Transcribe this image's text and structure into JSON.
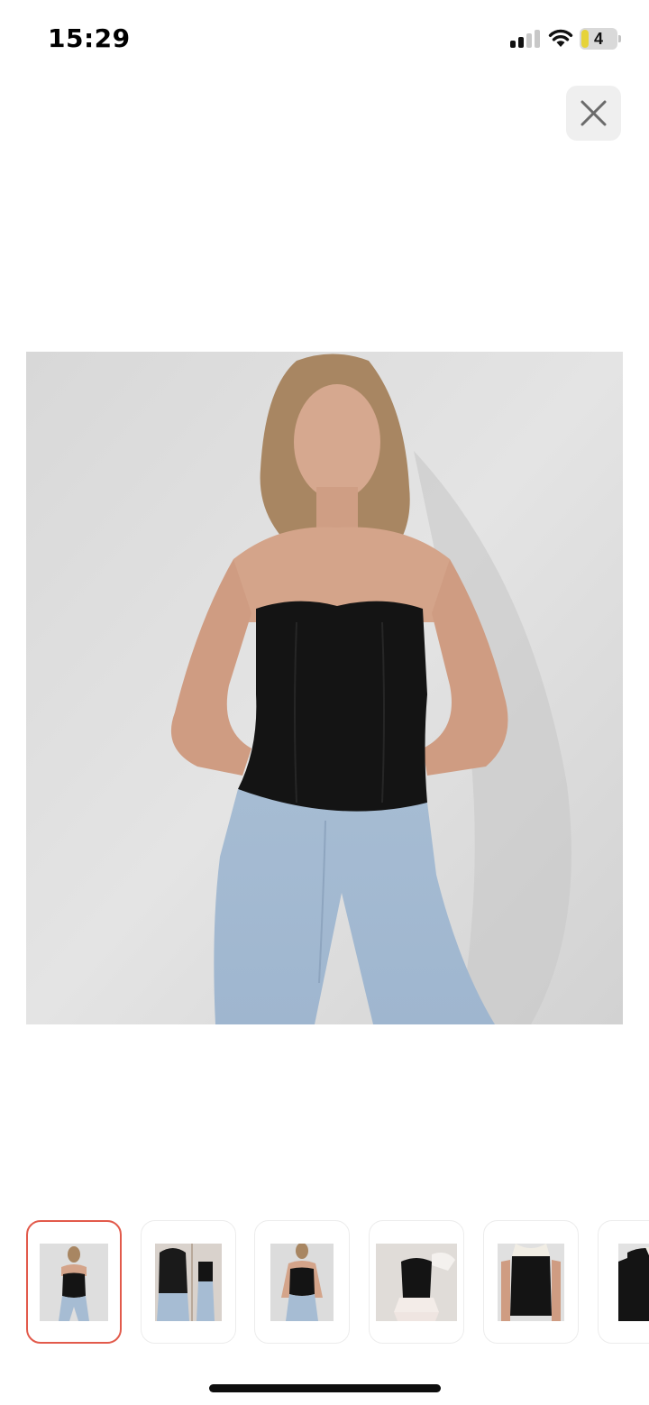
{
  "status_bar": {
    "time": "15:29",
    "battery_level": "4",
    "icons": [
      "signal-icon",
      "wifi-icon",
      "battery-icon"
    ]
  },
  "viewer": {
    "close_icon": "close-icon",
    "main_image": "product-photo-strapless-black-corset-top",
    "active_thumbnail": 1,
    "thumbnails": [
      "thumb-front-black-corset",
      "thumb-back-lace-up-corset",
      "thumb-front-black-corset-alt",
      "thumb-off-shoulder-ruffle-top",
      "thumb-black-white-top",
      "thumb-black-white-longsleeve"
    ]
  },
  "colors": {
    "active_border": "#e25a4b",
    "close_bg": "#efefef",
    "battery_fill": "#e6d33a"
  }
}
